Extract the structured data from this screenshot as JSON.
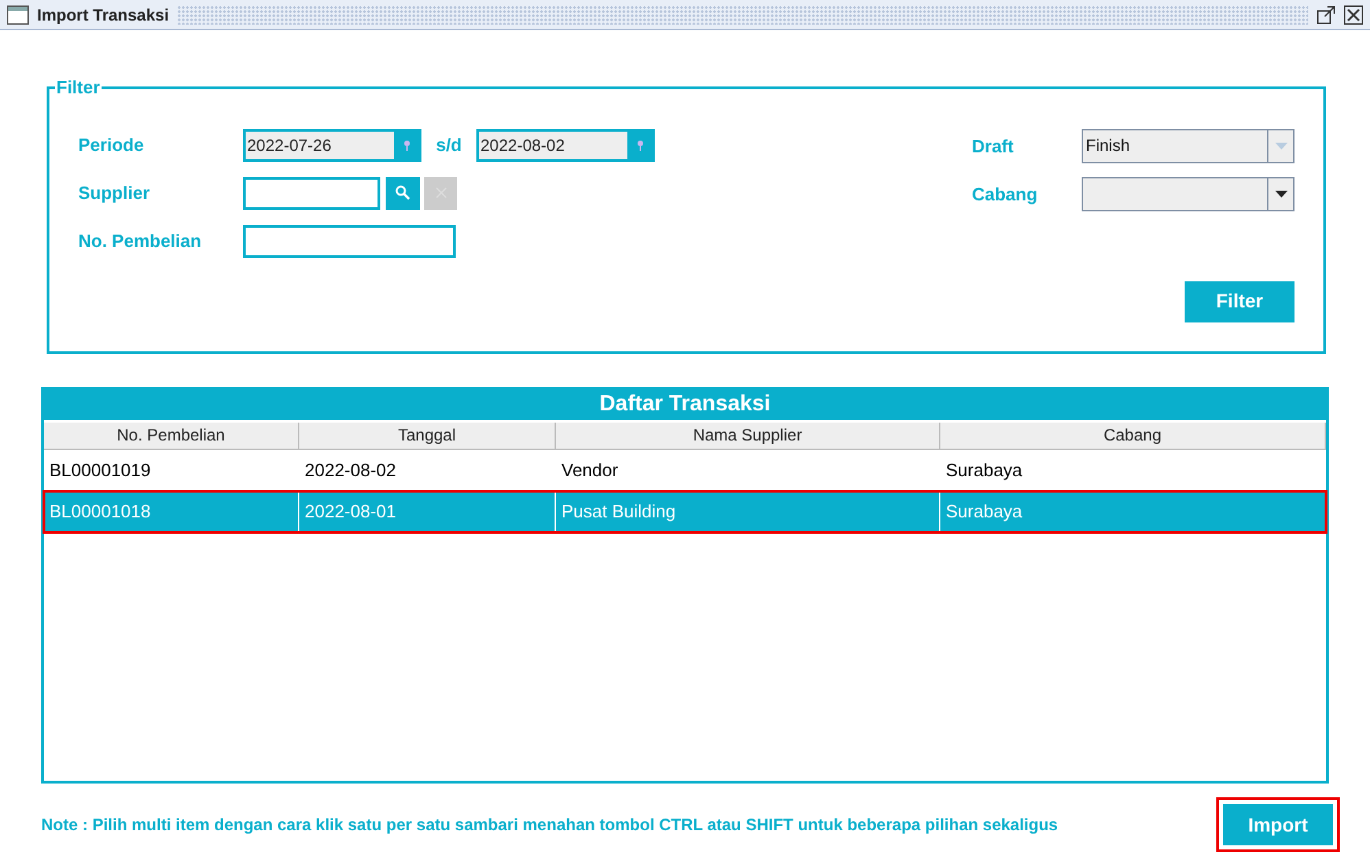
{
  "window": {
    "title": "Import Transaksi"
  },
  "filter": {
    "legend": "Filter",
    "periode": {
      "label": "Periode",
      "from": "2022-07-26",
      "separator": "s/d",
      "to": "2022-08-02"
    },
    "supplier": {
      "label": "Supplier"
    },
    "no_pembelian": {
      "label": "No. Pembelian"
    },
    "combos": [
      {
        "label": "Draft",
        "value": "Finish",
        "disabled": true
      },
      {
        "label": "Cabang",
        "disabled": false
      }
    ],
    "button": "Filter"
  },
  "table": {
    "title": "Daftar Transaksi",
    "columns": [
      "No. Pembelian",
      "Tanggal",
      "Nama Supplier",
      "Cabang"
    ],
    "rows": [
      {
        "cells": [
          "BL00001019",
          "2022-08-02",
          "Vendor",
          "Surabaya"
        ],
        "selected": false,
        "highlighted": false
      },
      {
        "cells": [
          "BL00001018",
          "2022-08-01",
          "Pusat Building",
          "Surabaya"
        ],
        "selected": true,
        "highlighted": true
      }
    ]
  },
  "note": "Note : Pilih multi item dengan cara klik satu per satu sambari menahan tombol CTRL atau SHIFT untuk beberapa pilihan sekaligus",
  "import_button": {
    "label": "Import",
    "highlighted": true
  }
}
